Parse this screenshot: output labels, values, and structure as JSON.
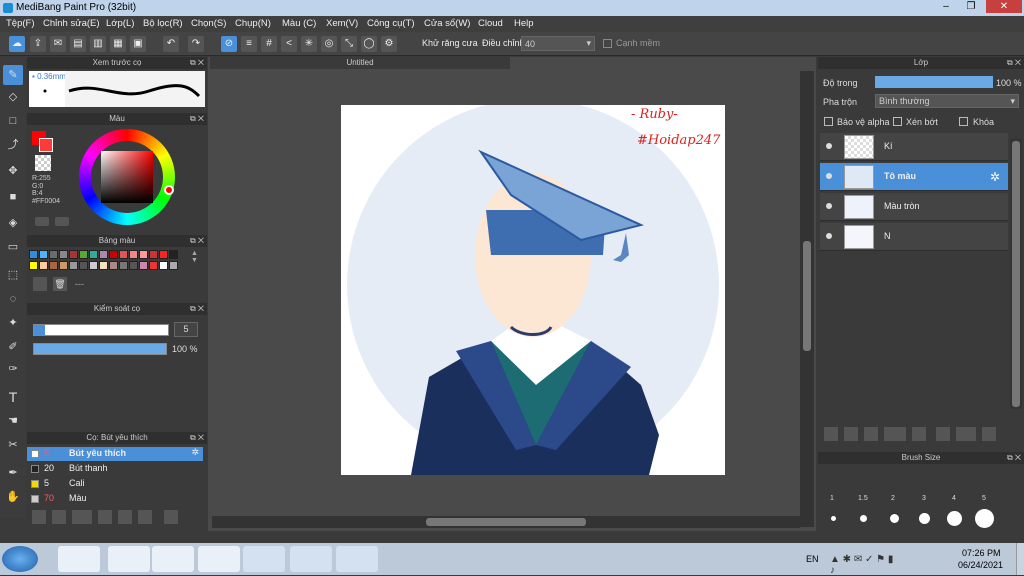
{
  "window": {
    "title": "MediBang Paint Pro (32bit)"
  },
  "menu": [
    "Tệp(F)",
    "Chỉnh sửa(E)",
    "Lớp(L)",
    "Bộ lọc(R)",
    "Chọn(S)",
    "Chụp(N)",
    "Màu (C)",
    "Xem(V)",
    "Công cụ(T)",
    "Cửa sổ(W)",
    "Cloud",
    "Help"
  ],
  "toolbar": {
    "antialias_label": "Khử răng cưa",
    "adjust_label": "Điều chỉnh",
    "adjust_value": "40",
    "sharp_label": "Cạnh mềm"
  },
  "panels": {
    "brush_preview": {
      "title": "Xem trước cọ",
      "size": "0.36mm"
    },
    "color": {
      "title": "Màu",
      "r": "R:255",
      "g": "G:0",
      "b": "B:4",
      "hex": "#FF0004",
      "primary": "#ff0004"
    },
    "palette": {
      "title": "Bảng màu",
      "dash": "---"
    },
    "brush_control": {
      "title": "Kiểm soát cọ",
      "size_value": "5",
      "opacity_value": "100 %"
    },
    "brush_list": {
      "title": "Cọ: Bút yêu thích",
      "items": [
        {
          "size": "5",
          "name": "Bút yêu thích",
          "color": "#ffffff"
        },
        {
          "size": "20",
          "name": "Bút thanh",
          "color": "#222222"
        },
        {
          "size": "5",
          "name": "Cali",
          "color": "#f5d800"
        },
        {
          "size": "70",
          "name": "Màu",
          "color": "#cccccc"
        }
      ]
    }
  },
  "document": {
    "tab": "Untitled",
    "watermark1": "- Ruby-",
    "watermark2": "#Hoidap247"
  },
  "layers": {
    "title": "Lớp",
    "opacity_label": "Độ trong",
    "opacity_value": "100 %",
    "blend_label": "Pha trộn",
    "blend_value": "Bình thường",
    "protect_alpha": "Bảo vệ alpha",
    "clip": "Xén bớt",
    "lock": "Khóa",
    "items": [
      {
        "name": "Kí"
      },
      {
        "name": "Tô màu"
      },
      {
        "name": "Màu tròn"
      },
      {
        "name": "N"
      }
    ]
  },
  "brush_size": {
    "title": "Brush Size",
    "labels": [
      "1",
      "1.5",
      "2",
      "3",
      "4",
      "5"
    ]
  },
  "taskbar": {
    "lang": "EN",
    "time": "07:26 PM",
    "date": "06/24/2021"
  }
}
